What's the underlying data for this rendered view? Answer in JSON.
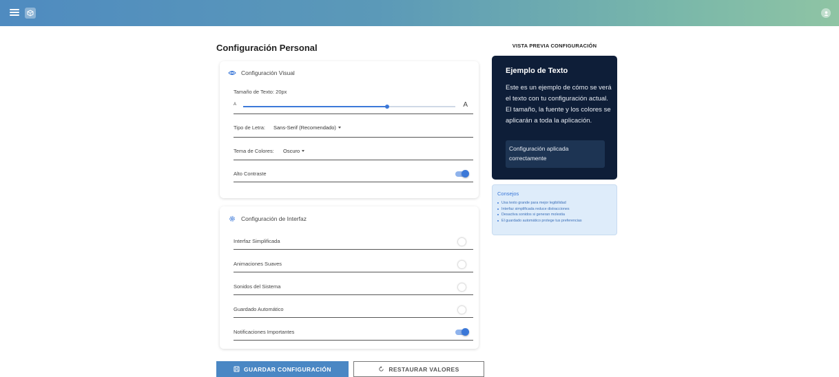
{
  "theme": {
    "accent": "#3b78d8",
    "preview_bg": "#0e1e38",
    "tips_bg": "#deecfa"
  },
  "header": {
    "menu_icon": "menu-icon",
    "logo_icon": "app-logo-icon",
    "user_icon": "user-avatar-icon"
  },
  "page": {
    "title": "Configuración Personal"
  },
  "visual_card": {
    "heading": "Configuración Visual",
    "heading_icon": "eye-icon",
    "text_size": {
      "label": "Tamaño de Texto: 20px",
      "min_label": "A",
      "max_label": "A",
      "value_fraction": 0.68
    },
    "font_type": {
      "label": "Tipo de Letra:",
      "value": "Sans-Serif (Recomendado)"
    },
    "color_theme": {
      "label": "Tema de Colores:",
      "value": "Oscuro"
    },
    "high_contrast": {
      "label": "Alto Contraste",
      "on": true
    }
  },
  "interface_card": {
    "heading": "Configuración de Interfaz",
    "heading_icon": "gear-icon",
    "toggles": [
      {
        "label": "Interfaz Simplificada",
        "on": false
      },
      {
        "label": "Animaciones Suaves",
        "on": false
      },
      {
        "label": "Sonidos del Sistema",
        "on": false
      },
      {
        "label": "Guardado Automático",
        "on": false
      },
      {
        "label": "Notificaciones Importantes",
        "on": true
      }
    ]
  },
  "actions": {
    "save_label": "GUARDAR CONFIGURACIÓN",
    "reset_label": "RESTAURAR VALORES"
  },
  "preview": {
    "heading": "VISTA PREVIA CONFIGURACIÓN",
    "title": "Ejemplo de Texto",
    "body": "Este es un ejemplo de cómo se verá el texto con tu configuración actual. El tamaño, la fuente y los colores se aplicarán a toda la aplicación.",
    "status": "Configuración aplicada correctamente"
  },
  "tips": {
    "title": "Consejos",
    "items": [
      "Usa texto grande para mejor legibilidad",
      "Interfaz simplificada reduce distracciones",
      "Desactiva sonidos si generan molestia",
      "El guardado automático protege tus preferencias"
    ]
  }
}
